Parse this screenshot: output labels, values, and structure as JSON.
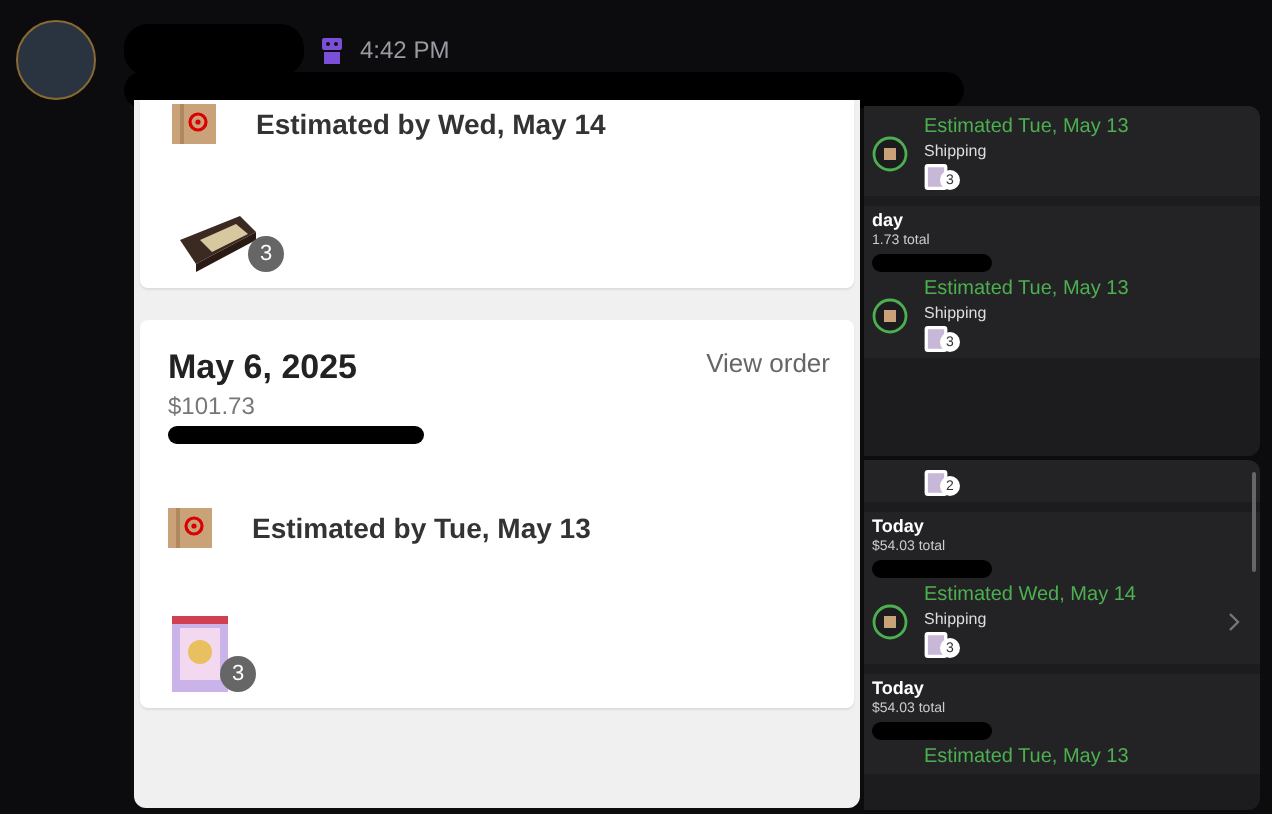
{
  "message": {
    "time": "4:42 PM"
  },
  "left_screenshot": {
    "cards": [
      {
        "shipment": {
          "estimate": "Estimated by Wed, May 14",
          "quantity": "3",
          "kind": "box"
        }
      },
      {
        "date": "May 6, 2025",
        "view_link": "View order",
        "total": "$101.73",
        "shipment": {
          "estimate": "Estimated by Tue, May 13",
          "quantity": "3",
          "kind": "binder"
        }
      }
    ]
  },
  "right_screenshots": [
    {
      "sections": [
        {
          "shipment": {
            "estimate": "Estimated Tue, May 13",
            "status": "Shipping",
            "quantity": "3",
            "chevron": false
          }
        },
        {
          "heading": "day",
          "total": "1.73 total",
          "shipment": {
            "estimate": "Estimated Tue, May 13",
            "status": "Shipping",
            "quantity": "3",
            "chevron": false
          }
        }
      ]
    },
    {
      "sections": [
        {
          "shipment": {
            "quantity": "2",
            "chevron": false
          }
        },
        {
          "heading": "Today",
          "total": "$54.03 total",
          "shipment": {
            "estimate": "Estimated Wed, May 14",
            "status": "Shipping",
            "quantity": "3",
            "chevron": true
          }
        },
        {
          "heading": "Today",
          "total": "$54.03 total",
          "shipment": {
            "estimate": "Estimated Tue, May 13",
            "chevron": false
          }
        }
      ]
    }
  ]
}
